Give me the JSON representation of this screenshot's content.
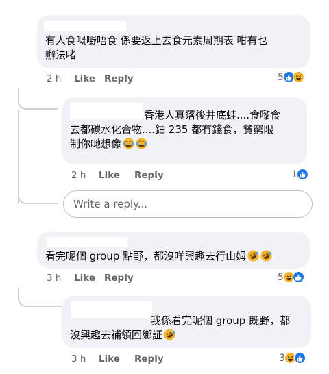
{
  "comments": [
    {
      "text_line1": "有人食嘅嘢唔食 係要返上去食元素周期表 咁有乜",
      "text_line2": "辦法啫",
      "time": "2 h",
      "like_label": "Like",
      "reply_label": "Reply",
      "reaction_count": "5",
      "reactions": [
        "like",
        "haha"
      ]
    },
    {
      "text_line1": "香港人真落後井底蛙....食嚟食",
      "text_line2": "去都碳水化合物....鈾 235 都冇錢食，貧窮限",
      "text_line3": "制你哋想像",
      "time": "2 h",
      "like_label": "Like",
      "reply_label": "Reply",
      "reaction_count": "1",
      "reactions": [
        "like"
      ]
    },
    {
      "text_line1": "看完呢個 group 點野，都沒咩興趣去行山姆",
      "time": "3 h",
      "like_label": "Like",
      "reply_label": "Reply",
      "reaction_count": "5",
      "reactions": [
        "haha",
        "like"
      ]
    },
    {
      "text_line1": "我係看完呢個 group 既野，都",
      "text_line2": "沒興趣去補領回鄉証",
      "time": "3 h",
      "like_label": "Like",
      "reply_label": "Reply",
      "reaction_count": "3",
      "reactions": [
        "haha",
        "like"
      ]
    }
  ],
  "reply_input": {
    "placeholder": "Write a reply..."
  },
  "colors": {
    "bubble": "#f0f2f5",
    "like_blue": "#1877f2",
    "haha_yellow": "#f7b125",
    "meta_gray": "#65676b"
  }
}
